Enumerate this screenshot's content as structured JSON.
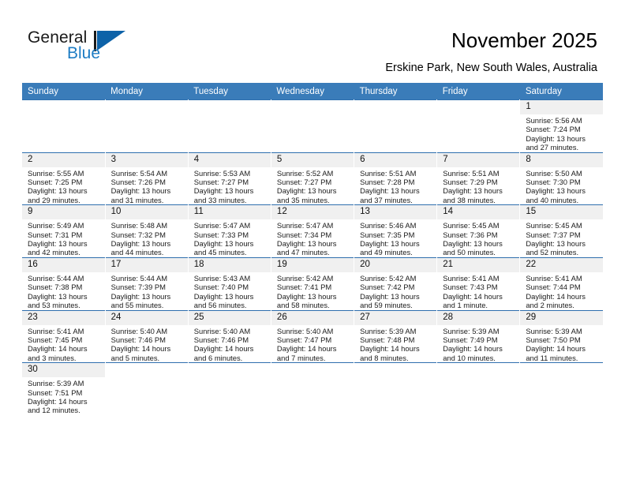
{
  "brand": {
    "name_top": "General",
    "name_bottom": "Blue",
    "accent_color": "#0d62a8",
    "text_color": "#1d7cc4"
  },
  "header": {
    "title": "November 2025",
    "subtitle": "Erskine Park, New South Wales, Australia",
    "header_bg": "#3a7cb9",
    "row_divider": "#2f6fae",
    "daynum_bg": "#f0f0f0"
  },
  "weekday_headers": [
    "Sunday",
    "Monday",
    "Tuesday",
    "Wednesday",
    "Thursday",
    "Friday",
    "Saturday"
  ],
  "weeks": [
    [
      {
        "day": "",
        "blank": true
      },
      {
        "day": "",
        "blank": true
      },
      {
        "day": "",
        "blank": true
      },
      {
        "day": "",
        "blank": true
      },
      {
        "day": "",
        "blank": true
      },
      {
        "day": "",
        "blank": true
      },
      {
        "day": "1",
        "sunrise": "Sunrise: 5:56 AM",
        "sunset": "Sunset: 7:24 PM",
        "daylight1": "Daylight: 13 hours",
        "daylight2": "and 27 minutes."
      }
    ],
    [
      {
        "day": "2",
        "sunrise": "Sunrise: 5:55 AM",
        "sunset": "Sunset: 7:25 PM",
        "daylight1": "Daylight: 13 hours",
        "daylight2": "and 29 minutes."
      },
      {
        "day": "3",
        "sunrise": "Sunrise: 5:54 AM",
        "sunset": "Sunset: 7:26 PM",
        "daylight1": "Daylight: 13 hours",
        "daylight2": "and 31 minutes."
      },
      {
        "day": "4",
        "sunrise": "Sunrise: 5:53 AM",
        "sunset": "Sunset: 7:27 PM",
        "daylight1": "Daylight: 13 hours",
        "daylight2": "and 33 minutes."
      },
      {
        "day": "5",
        "sunrise": "Sunrise: 5:52 AM",
        "sunset": "Sunset: 7:27 PM",
        "daylight1": "Daylight: 13 hours",
        "daylight2": "and 35 minutes."
      },
      {
        "day": "6",
        "sunrise": "Sunrise: 5:51 AM",
        "sunset": "Sunset: 7:28 PM",
        "daylight1": "Daylight: 13 hours",
        "daylight2": "and 37 minutes."
      },
      {
        "day": "7",
        "sunrise": "Sunrise: 5:51 AM",
        "sunset": "Sunset: 7:29 PM",
        "daylight1": "Daylight: 13 hours",
        "daylight2": "and 38 minutes."
      },
      {
        "day": "8",
        "sunrise": "Sunrise: 5:50 AM",
        "sunset": "Sunset: 7:30 PM",
        "daylight1": "Daylight: 13 hours",
        "daylight2": "and 40 minutes."
      }
    ],
    [
      {
        "day": "9",
        "sunrise": "Sunrise: 5:49 AM",
        "sunset": "Sunset: 7:31 PM",
        "daylight1": "Daylight: 13 hours",
        "daylight2": "and 42 minutes."
      },
      {
        "day": "10",
        "sunrise": "Sunrise: 5:48 AM",
        "sunset": "Sunset: 7:32 PM",
        "daylight1": "Daylight: 13 hours",
        "daylight2": "and 44 minutes."
      },
      {
        "day": "11",
        "sunrise": "Sunrise: 5:47 AM",
        "sunset": "Sunset: 7:33 PM",
        "daylight1": "Daylight: 13 hours",
        "daylight2": "and 45 minutes."
      },
      {
        "day": "12",
        "sunrise": "Sunrise: 5:47 AM",
        "sunset": "Sunset: 7:34 PM",
        "daylight1": "Daylight: 13 hours",
        "daylight2": "and 47 minutes."
      },
      {
        "day": "13",
        "sunrise": "Sunrise: 5:46 AM",
        "sunset": "Sunset: 7:35 PM",
        "daylight1": "Daylight: 13 hours",
        "daylight2": "and 49 minutes."
      },
      {
        "day": "14",
        "sunrise": "Sunrise: 5:45 AM",
        "sunset": "Sunset: 7:36 PM",
        "daylight1": "Daylight: 13 hours",
        "daylight2": "and 50 minutes."
      },
      {
        "day": "15",
        "sunrise": "Sunrise: 5:45 AM",
        "sunset": "Sunset: 7:37 PM",
        "daylight1": "Daylight: 13 hours",
        "daylight2": "and 52 minutes."
      }
    ],
    [
      {
        "day": "16",
        "sunrise": "Sunrise: 5:44 AM",
        "sunset": "Sunset: 7:38 PM",
        "daylight1": "Daylight: 13 hours",
        "daylight2": "and 53 minutes."
      },
      {
        "day": "17",
        "sunrise": "Sunrise: 5:44 AM",
        "sunset": "Sunset: 7:39 PM",
        "daylight1": "Daylight: 13 hours",
        "daylight2": "and 55 minutes."
      },
      {
        "day": "18",
        "sunrise": "Sunrise: 5:43 AM",
        "sunset": "Sunset: 7:40 PM",
        "daylight1": "Daylight: 13 hours",
        "daylight2": "and 56 minutes."
      },
      {
        "day": "19",
        "sunrise": "Sunrise: 5:42 AM",
        "sunset": "Sunset: 7:41 PM",
        "daylight1": "Daylight: 13 hours",
        "daylight2": "and 58 minutes."
      },
      {
        "day": "20",
        "sunrise": "Sunrise: 5:42 AM",
        "sunset": "Sunset: 7:42 PM",
        "daylight1": "Daylight: 13 hours",
        "daylight2": "and 59 minutes."
      },
      {
        "day": "21",
        "sunrise": "Sunrise: 5:41 AM",
        "sunset": "Sunset: 7:43 PM",
        "daylight1": "Daylight: 14 hours",
        "daylight2": "and 1 minute."
      },
      {
        "day": "22",
        "sunrise": "Sunrise: 5:41 AM",
        "sunset": "Sunset: 7:44 PM",
        "daylight1": "Daylight: 14 hours",
        "daylight2": "and 2 minutes."
      }
    ],
    [
      {
        "day": "23",
        "sunrise": "Sunrise: 5:41 AM",
        "sunset": "Sunset: 7:45 PM",
        "daylight1": "Daylight: 14 hours",
        "daylight2": "and 3 minutes."
      },
      {
        "day": "24",
        "sunrise": "Sunrise: 5:40 AM",
        "sunset": "Sunset: 7:46 PM",
        "daylight1": "Daylight: 14 hours",
        "daylight2": "and 5 minutes."
      },
      {
        "day": "25",
        "sunrise": "Sunrise: 5:40 AM",
        "sunset": "Sunset: 7:46 PM",
        "daylight1": "Daylight: 14 hours",
        "daylight2": "and 6 minutes."
      },
      {
        "day": "26",
        "sunrise": "Sunrise: 5:40 AM",
        "sunset": "Sunset: 7:47 PM",
        "daylight1": "Daylight: 14 hours",
        "daylight2": "and 7 minutes."
      },
      {
        "day": "27",
        "sunrise": "Sunrise: 5:39 AM",
        "sunset": "Sunset: 7:48 PM",
        "daylight1": "Daylight: 14 hours",
        "daylight2": "and 8 minutes."
      },
      {
        "day": "28",
        "sunrise": "Sunrise: 5:39 AM",
        "sunset": "Sunset: 7:49 PM",
        "daylight1": "Daylight: 14 hours",
        "daylight2": "and 10 minutes."
      },
      {
        "day": "29",
        "sunrise": "Sunrise: 5:39 AM",
        "sunset": "Sunset: 7:50 PM",
        "daylight1": "Daylight: 14 hours",
        "daylight2": "and 11 minutes."
      }
    ],
    [
      {
        "day": "30",
        "sunrise": "Sunrise: 5:39 AM",
        "sunset": "Sunset: 7:51 PM",
        "daylight1": "Daylight: 14 hours",
        "daylight2": "and 12 minutes."
      },
      {
        "day": "",
        "blank": true
      },
      {
        "day": "",
        "blank": true
      },
      {
        "day": "",
        "blank": true
      },
      {
        "day": "",
        "blank": true
      },
      {
        "day": "",
        "blank": true
      },
      {
        "day": "",
        "blank": true
      }
    ]
  ]
}
